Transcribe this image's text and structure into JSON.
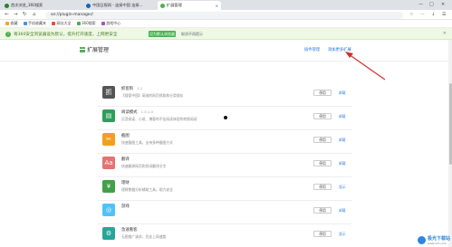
{
  "browser": {
    "tabs": [
      {
        "label": "首次浏览_360搜索",
        "color": "#2e7d32",
        "active": false
      },
      {
        "label": "中国日报网 - 连接中国 连接...",
        "color": "#1565c0",
        "active": false
      },
      {
        "label": "扩展管理",
        "color": "#4caf50",
        "active": true
      }
    ],
    "window_controls": [
      "—",
      "□",
      "✕"
    ],
    "nav": {
      "back": "←",
      "forward": "→",
      "reload": "↻",
      "home": "⌂"
    },
    "url": "se://plugin-manager/",
    "tools": [
      "☆",
      "⋯",
      "↓",
      "☰"
    ]
  },
  "bookmarks": [
    {
      "label": "收藏",
      "color": "#f5a623"
    },
    {
      "label": "手机收藏夹",
      "color": "#4a90e2"
    },
    {
      "label": "网址大全",
      "color": "#e94e3c"
    },
    {
      "label": "360搜索",
      "color": "#4caf50"
    },
    {
      "label": "游戏中心",
      "color": "#9b59b6"
    }
  ],
  "notice": {
    "icon": "!",
    "text": "将360安全浏览器设为默认，提升打开速度，上网更安全",
    "primary_btn": "设为默认浏览器",
    "secondary_btn": "取消不再提示",
    "close": "✕"
  },
  "page": {
    "title": "扩展管理",
    "links": {
      "store": "插件管理",
      "add_local": "添加更多扩展"
    }
  },
  "extensions": [
    {
      "name": "抓客狗",
      "version": "1.1",
      "desc": "【搜索中国】高效的网页抓取和分类保存",
      "icon": "抓",
      "color": "#555555",
      "btn": "停用",
      "link": "卸载"
    },
    {
      "name": "阅读模式",
      "version": "1.0.1.0",
      "desc": "沉浸阅读、小说、博客的不佳阅读体验的转换阅读",
      "icon": "▤",
      "color": "#2e9e5a",
      "btn": "停用",
      "link": "卸载"
    },
    {
      "name": "截图",
      "version": "",
      "desc": "快速截图工具，支持多种截图方式",
      "icon": "✂",
      "color": "#f0a020",
      "btn": "停用",
      "link": "卸载"
    },
    {
      "name": "翻译",
      "version": "",
      "desc": "快速翻译网页和划词翻译文字",
      "icon": "Aa",
      "color": "#e57373",
      "btn": "停用",
      "link": "卸载"
    },
    {
      "name": "理财",
      "version": "",
      "desc": "理财数据分析辅助工具，助力安全",
      "icon": "¥",
      "color": "#43a047",
      "btn": "停用",
      "link": "显示"
    },
    {
      "name": "游戏",
      "version": "",
      "desc": "",
      "icon": "◎",
      "color": "#4fc3f7",
      "btn": "停用",
      "link": "卸载"
    },
    {
      "name": "急速看客",
      "version": "",
      "desc": "无图推广请求，优化上网速度",
      "icon": "⚙",
      "color": "#26a69a",
      "btn": "停用",
      "link": "显示"
    }
  ],
  "watermark": {
    "text": "极光下载站",
    "sub": "www.xz7.com"
  }
}
